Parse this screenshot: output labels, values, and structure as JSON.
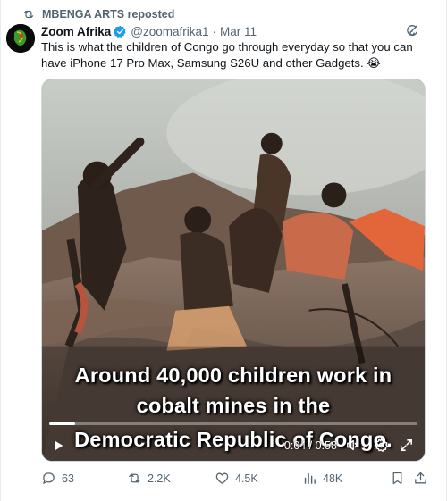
{
  "repost": {
    "label": "MBENGA ARTS reposted"
  },
  "author": {
    "name": "Zoom Afrika",
    "handle": "@zoomafrika1",
    "separator": "·",
    "date": "Mar 11"
  },
  "tweet": {
    "text": "This is what the children of Congo go through everyday so that you can have iPhone 17 Pro Max, Samsung S26U and other Gadgets. 😭"
  },
  "video": {
    "caption_lines": [
      "Around 40,000 children work in",
      "cobalt mines in the",
      "Democratic Republic of Congo."
    ],
    "time_display": "0:04 / 0:58",
    "progress_fraction": 0.07
  },
  "actions": {
    "replies": "63",
    "reposts": "2.2K",
    "likes": "4.5K",
    "views": "48K"
  },
  "colors": {
    "accent": "#1d9bf0",
    "muted": "#536471",
    "text": "#0f1419",
    "border": "#cfd9de"
  },
  "icons": [
    "repost-icon",
    "verified-badge-icon",
    "grok-icon",
    "more-icon",
    "play-icon",
    "volume-icon",
    "settings-icon",
    "fullscreen-icon",
    "reply-icon",
    "like-icon",
    "views-icon",
    "bookmark-icon",
    "share-icon"
  ]
}
